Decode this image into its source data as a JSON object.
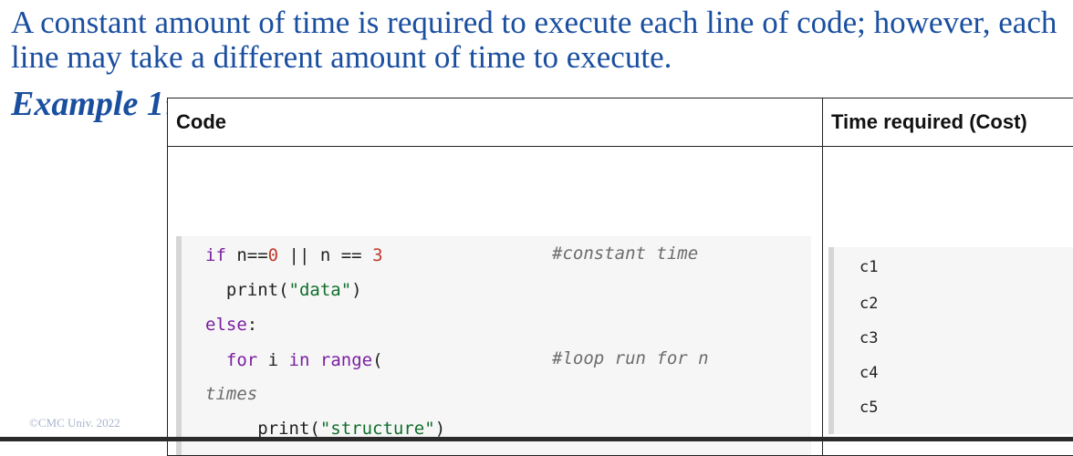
{
  "intro_text": "A constant amount of time is required to execute each line of code; however, each line may take a different amount of time to execute.",
  "example_label": "Example 1",
  "example_colon": ":",
  "table": {
    "header_code": "Code",
    "header_cost": "Time required (Cost)"
  },
  "code": {
    "l1_kw": "if",
    "l1_a": " n==",
    "l1_n1": "0",
    "l1_b": " || n == ",
    "l1_n2": "3",
    "l1_comment": "#constant time",
    "l2_a": "  print(",
    "l2_str": "\"data\"",
    "l2_b": ")",
    "l3_kw": "else",
    "l3_b": ":",
    "l4_kw1": "  for",
    "l4_a": " i ",
    "l4_kw2": "in",
    "l4_sp": " ",
    "l4_kw3": "range",
    "l4_b": "(",
    "l4_comment": "#loop run for n",
    "l5": "times",
    "l6_a": "     print(",
    "l6_str": "\"structure\"",
    "l6_b": ")"
  },
  "costs": [
    "c1",
    "c2",
    "c3",
    "c4",
    "c5"
  ],
  "footer": "©CMC Univ. 2022"
}
